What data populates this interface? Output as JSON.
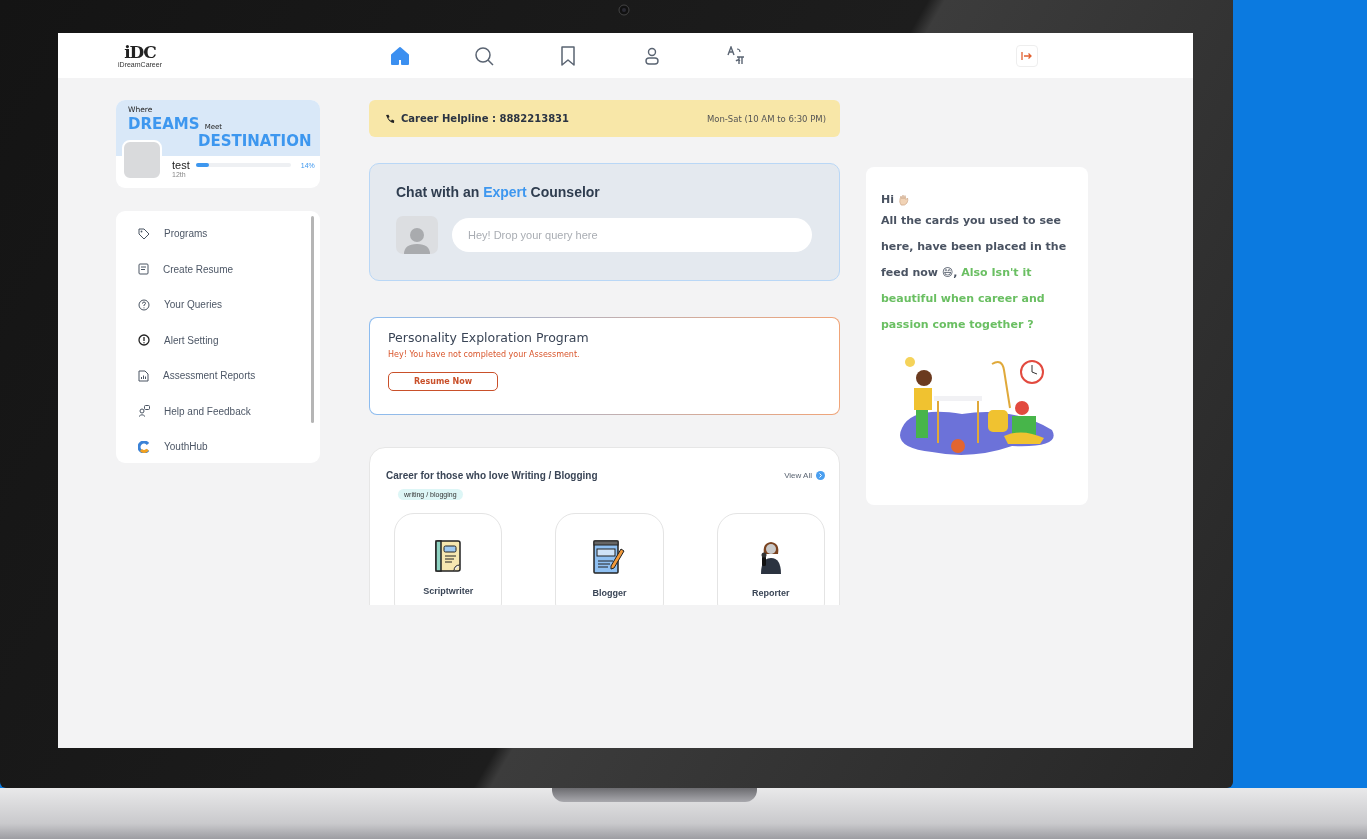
{
  "logo": {
    "mark": "iDC",
    "name": "iDreamCareer"
  },
  "nav_items": [
    {
      "kind": "home",
      "selected": true
    },
    {
      "kind": "search",
      "selected": false
    },
    {
      "kind": "bookmark",
      "selected": false
    },
    {
      "kind": "profile",
      "selected": false
    },
    {
      "kind": "translate",
      "selected": false
    }
  ],
  "profile": {
    "tagline_1": "Where",
    "tagline_2": "DREAMS",
    "tagline_3": "Meet",
    "tagline_4": "DESTINATION",
    "name": "test",
    "grade": "12th",
    "level": 0.14,
    "reading": "14%"
  },
  "menu": [
    {
      "kind": "tag",
      "label": "Programs"
    },
    {
      "kind": "note",
      "label": "Create Resume"
    },
    {
      "kind": "question",
      "label": "Your Queries"
    },
    {
      "kind": "alert",
      "label": "Alert Setting"
    },
    {
      "kind": "report",
      "label": "Assessment Reports"
    },
    {
      "kind": "help",
      "label": "Help and Feedback"
    },
    {
      "kind": "youthhub",
      "label": "YouthHub"
    }
  ],
  "helpline": {
    "text": "Career Helpline : 8882213831",
    "hours": "Mon-Sat (10 AM to 6:30 PM)"
  },
  "chat": {
    "title_before": "Chat with an",
    "title_highlight": "Expert",
    "title_after": "Counselor",
    "placeholder": "Hey! Drop your query here"
  },
  "assessment": {
    "title": "Personality Exploration Program",
    "message": "Hey! You have not completed your Assessment.",
    "button": "Resume Now"
  },
  "careers": {
    "title": "Career for those who love Writing / Blogging",
    "view_all": "View All",
    "tag": "writing / blogging",
    "items": [
      {
        "kind": "script",
        "label": "Scriptwriter"
      },
      {
        "kind": "blog",
        "label": "Blogger"
      },
      {
        "kind": "reporter",
        "label": "Reporter"
      }
    ]
  },
  "notice": {
    "greeting": "Hi",
    "message": "All the cards you used to see here, have been placed in the feed now 😄,",
    "highlight": "Also Isn't it beautiful when career and passion come together ?"
  }
}
